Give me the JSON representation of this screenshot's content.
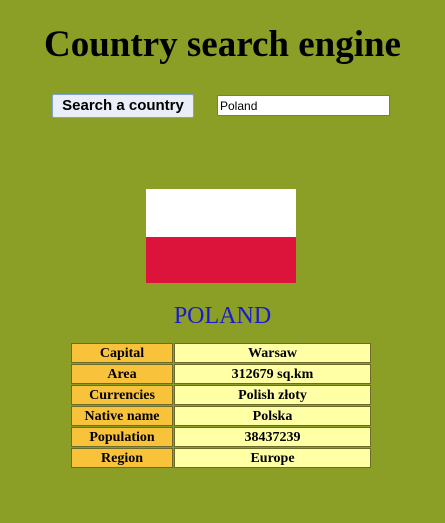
{
  "page": {
    "title": "Country search engine"
  },
  "search": {
    "button_label": "Search a country",
    "input_value": "Poland"
  },
  "country": {
    "name": "POLAND",
    "flag": {
      "top_color": "#ffffff",
      "bottom_color": "#dc143c"
    }
  },
  "details": [
    {
      "label": "Capital",
      "value": "Warsaw"
    },
    {
      "label": "Area",
      "value": "312679 sq.km"
    },
    {
      "label": "Currencies",
      "value": "Polish złoty"
    },
    {
      "label": "Native name",
      "value": "Polska"
    },
    {
      "label": "Population",
      "value": "38437239"
    },
    {
      "label": "Region",
      "value": "Europe"
    }
  ],
  "colors": {
    "background": "#8b9f27",
    "label_cell": "#f8c33a",
    "value_cell": "#ffffa6",
    "country_name": "#1a1ad0"
  }
}
